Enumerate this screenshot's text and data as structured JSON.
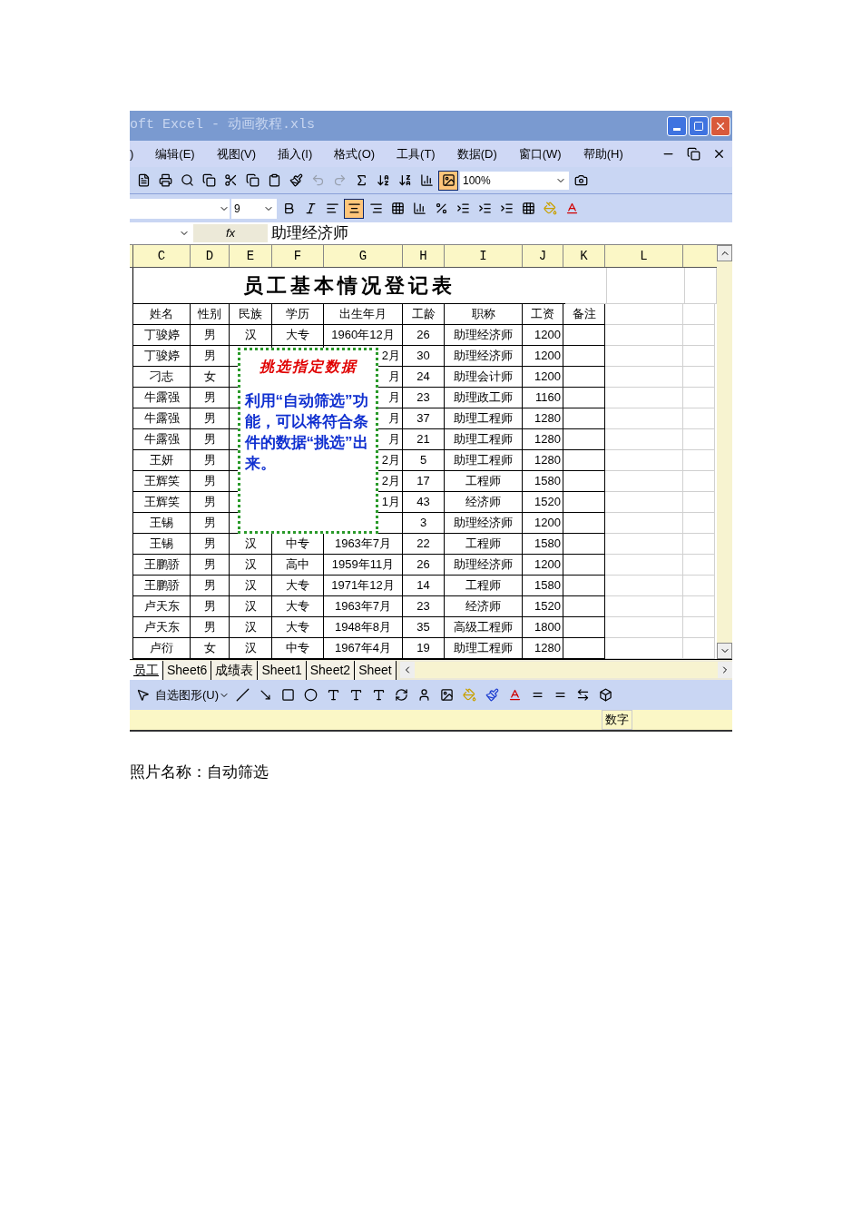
{
  "window": {
    "title": "oft Excel - 动画教程.xls"
  },
  "menu": {
    "items": [
      ")",
      "编辑(E)",
      "视图(V)",
      "插入(I)",
      "格式(O)",
      "工具(T)",
      "数据(D)",
      "窗口(W)",
      "帮助(H)"
    ]
  },
  "toolbar": {
    "zoom": "100%",
    "font_size": "9"
  },
  "formula_bar": {
    "fx": "fx",
    "value": "助理经济师"
  },
  "sheet": {
    "columns": [
      "C",
      "D",
      "E",
      "F",
      "G",
      "H",
      "I",
      "J",
      "K",
      "L"
    ],
    "title": "员工基本情况登记表",
    "headers": [
      "姓名",
      "性别",
      "民族",
      "学历",
      "出生年月",
      "工龄",
      "职称",
      "工资",
      "备注"
    ],
    "rows": [
      {
        "name": "丁骏婷",
        "gender": "男",
        "ethnicity": "汉",
        "education": "大专",
        "birth": "1960年12月",
        "years": "26",
        "title": "助理经济师",
        "salary": "1200"
      },
      {
        "name": "丁骏婷",
        "gender": "男",
        "birth": "2月",
        "years": "30",
        "title": "助理经济师",
        "salary": "1200"
      },
      {
        "name": "刁志",
        "gender": "女",
        "birth": "月",
        "years": "24",
        "title": "助理会计师",
        "salary": "1200"
      },
      {
        "name": "牛露强",
        "gender": "男",
        "birth": "月",
        "years": "23",
        "title": "助理政工师",
        "salary": "1160"
      },
      {
        "name": "牛露强",
        "gender": "男",
        "birth": "月",
        "years": "37",
        "title": "助理工程师",
        "salary": "1280"
      },
      {
        "name": "牛露强",
        "gender": "男",
        "birth": "月",
        "years": "21",
        "title": "助理工程师",
        "salary": "1280"
      },
      {
        "name": "王妍",
        "gender": "男",
        "birth": "2月",
        "years": "5",
        "title": "助理工程师",
        "salary": "1280"
      },
      {
        "name": "王辉笑",
        "gender": "男",
        "birth": "2月",
        "years": "17",
        "title": "工程师",
        "salary": "1580"
      },
      {
        "name": "王辉笑",
        "gender": "男",
        "birth": "1月",
        "years": "43",
        "title": "经济师",
        "salary": "1520"
      },
      {
        "name": "王锡",
        "gender": "男",
        "years": "3",
        "title": "助理经济师",
        "salary": "1200"
      },
      {
        "name": "王锡",
        "gender": "男",
        "ethnicity": "汉",
        "education": "中专",
        "birth": "1963年7月",
        "years": "22",
        "title": "工程师",
        "salary": "1580"
      },
      {
        "name": "王鹏骄",
        "gender": "男",
        "ethnicity": "汉",
        "education": "高中",
        "birth": "1959年11月",
        "years": "26",
        "title": "助理经济师",
        "salary": "1200"
      },
      {
        "name": "王鹏骄",
        "gender": "男",
        "ethnicity": "汉",
        "education": "大专",
        "birth": "1971年12月",
        "years": "14",
        "title": "工程师",
        "salary": "1580"
      },
      {
        "name": "卢天东",
        "gender": "男",
        "ethnicity": "汉",
        "education": "大专",
        "birth": "1963年7月",
        "years": "23",
        "title": "经济师",
        "salary": "1520"
      },
      {
        "name": "卢天东",
        "gender": "男",
        "ethnicity": "汉",
        "education": "大专",
        "birth": "1948年8月",
        "years": "35",
        "title": "高级工程师",
        "salary": "1800"
      },
      {
        "name": "卢衍",
        "gender": "女",
        "ethnicity": "汉",
        "education": "中专",
        "birth": "1967年4月",
        "years": "19",
        "title": "助理工程师",
        "salary": "1280"
      }
    ]
  },
  "callout": {
    "title": "挑选指定数据",
    "text": "利用“自动筛选”功能，可以将符合条件的数据“挑选”出来。"
  },
  "sheet_tabs": [
    {
      "label": "员工",
      "selected": true
    },
    {
      "label": "Sheet6",
      "selected": false
    },
    {
      "label": "成绩表",
      "selected": false
    },
    {
      "label": "Sheet1",
      "selected": false
    },
    {
      "label": "Sheet2",
      "selected": false
    },
    {
      "label": "Sheet",
      "selected": false
    }
  ],
  "drawing_toolbar": {
    "autoshapes": "自选图形(U)"
  },
  "status_bar": {
    "mode": "数字"
  },
  "caption": "照片名称：自动筛选"
}
